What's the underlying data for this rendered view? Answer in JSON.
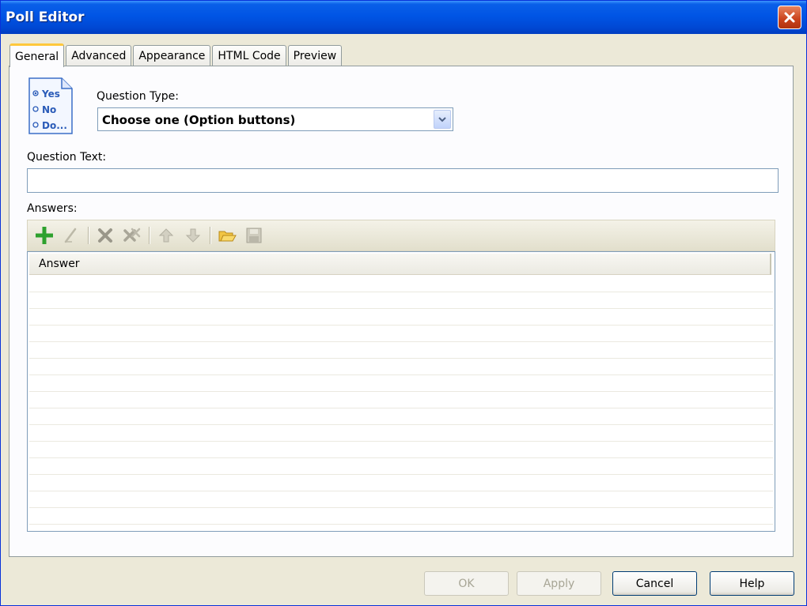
{
  "window": {
    "title": "Poll Editor"
  },
  "tabs": [
    {
      "label": "General",
      "active": true
    },
    {
      "label": "Advanced",
      "active": false
    },
    {
      "label": "Appearance",
      "active": false
    },
    {
      "label": "HTML Code",
      "active": false
    },
    {
      "label": "Preview",
      "active": false
    }
  ],
  "general": {
    "icon_lines": [
      "Yes",
      "No",
      "Do..."
    ],
    "question_type_label": "Question Type:",
    "question_type_value": "Choose one (Option buttons)",
    "question_text_label": "Question Text:",
    "question_text_value": "",
    "answers_label": "Answers:",
    "toolbar_icons": [
      "add-icon",
      "edit-icon",
      "delete-icon",
      "delete-all-icon",
      "move-up-icon",
      "move-down-icon",
      "open-folder-icon",
      "save-icon"
    ],
    "grid_column": "Answer",
    "answers": []
  },
  "buttons": {
    "ok": "OK",
    "apply": "Apply",
    "cancel": "Cancel",
    "help": "Help"
  },
  "colors": {
    "titlebar": "#0055e5",
    "active_tab_accent": "#ffc83c",
    "add_icon": "#2ea12e"
  }
}
